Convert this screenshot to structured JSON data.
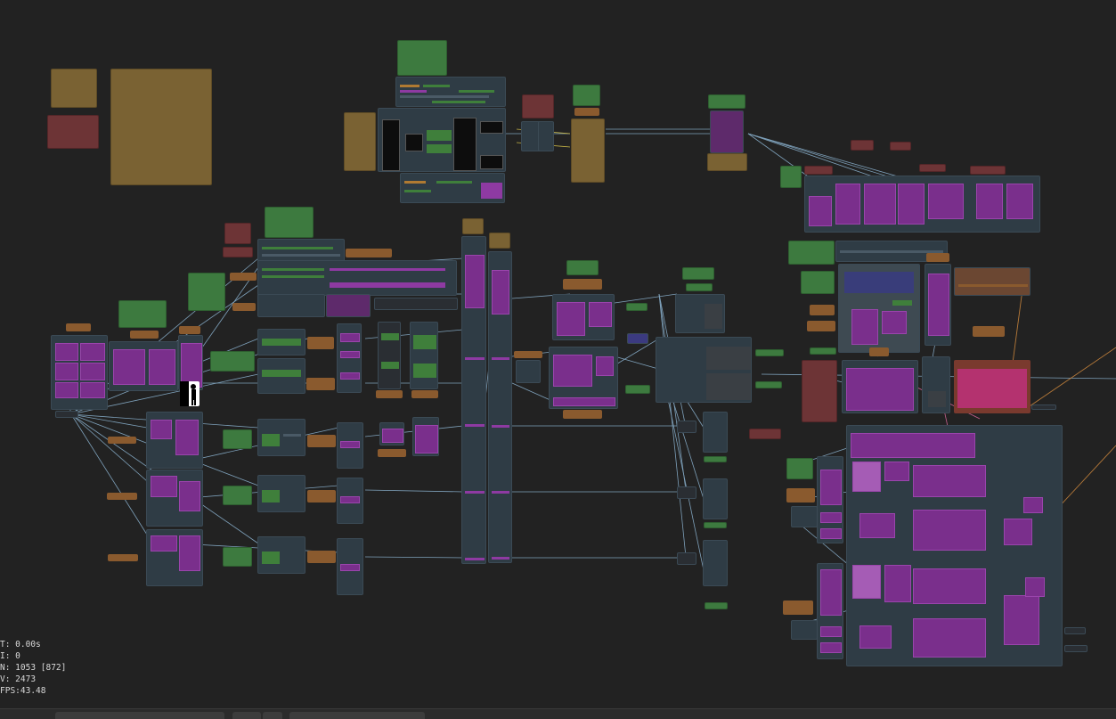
{
  "app": "node-graph-editor",
  "stats": {
    "t": "T: 0.00s",
    "i": "I: 0",
    "n": "N: 1053 [872]",
    "v": "V: 2473",
    "fps": "FPS:43.48"
  },
  "colors": {
    "background": "#222222",
    "node_body": "#2f3c45",
    "note_green": "#3d7a3f",
    "note_gold": "#7a6233",
    "note_red": "#6d3436",
    "image_preview": "#7a2f8c",
    "wire_blue": "#8fb8d6",
    "wire_yellow": "#d6c34a",
    "wire_orange": "#c8843c",
    "wire_pink": "#e06aa0"
  },
  "icons": [
    "person-silhouette-icon"
  ],
  "bottom_tabs": [
    "",
    "",
    "",
    ""
  ]
}
